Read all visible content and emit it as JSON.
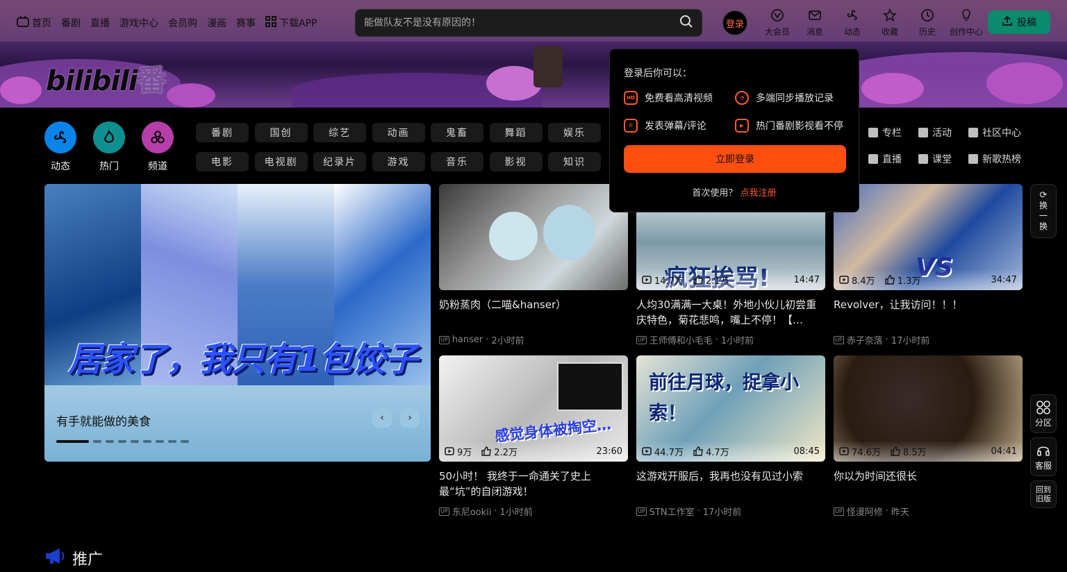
{
  "nav": {
    "menu": [
      "首页",
      "番剧",
      "直播",
      "游戏中心",
      "会员购",
      "漫画",
      "赛事",
      "下载APP"
    ],
    "search_placeholder": "能做队友不是没有原因的！",
    "login": "登录",
    "right_items": [
      "大会员",
      "消息",
      "动态",
      "收藏",
      "历史",
      "创作中心"
    ],
    "upload": "投稿"
  },
  "banner": {
    "logo_text": "bilibili",
    "logo_suffix": "番"
  },
  "channels": {
    "icons": [
      {
        "label": "动态",
        "color": "#0a84e8"
      },
      {
        "label": "热门",
        "color": "#0f8f8f"
      },
      {
        "label": "频道",
        "color": "#b63ea8"
      }
    ],
    "tags": [
      "番剧",
      "国创",
      "综艺",
      "动画",
      "鬼畜",
      "舞蹈",
      "娱乐",
      "电影",
      "电视剧",
      "纪录片",
      "游戏",
      "音乐",
      "影视",
      "知识"
    ],
    "extra": [
      "专栏",
      "活动",
      "社区中心",
      "直播",
      "课堂",
      "新歌热榜"
    ]
  },
  "carousel": {
    "overlay_text": "居家了，我只有1包饺子",
    "caption": "有手就能做的美食",
    "prev": "‹",
    "next": "›",
    "dot_count": 9
  },
  "cards": [
    {
      "title": "奶粉蒸肉（二喵&hanser）",
      "author": "hanser",
      "time": "2小时前",
      "plays": "",
      "likes": "",
      "duration": ""
    },
    {
      "title": "人均30满满一大桌！外地小伙儿初尝重庆特色，菊花悲鸣，嘴上不停！【…",
      "author": "王师傅和小毛毛",
      "time": "1小时前",
      "plays": "14.7万",
      "likes": "2.1万",
      "duration": "14:47",
      "overlay": "疯狂挨骂!"
    },
    {
      "title": "Revolver，让我访问！！！",
      "author": "赤子奈落",
      "time": "17小时前",
      "plays": "8.4万",
      "likes": "1.3万",
      "duration": "34:47",
      "overlay": "VS"
    },
    {
      "title": "50小时！ 我终于一命通关了史上最“坑”的自闭游戏！",
      "author": "东尼ookii",
      "time": "1小时前",
      "plays": "9万",
      "likes": "2.2万",
      "duration": "23:60",
      "overlay": "感觉身体被掏空…"
    },
    {
      "title": "这游戏开服后，我再也没有见过小索",
      "author": "STN工作室",
      "time": "17小时前",
      "plays": "44.7万",
      "likes": "4.7万",
      "duration": "08:45",
      "overlay": "前往月球，捉拿小索！"
    },
    {
      "title": "你以为时间还很长",
      "author": "怪漫阿修",
      "time": "昨天",
      "plays": "74.6万",
      "likes": "8.5万",
      "duration": "04:41"
    }
  ],
  "popover": {
    "heading": "登录后你可以：",
    "items": [
      "免费看高清视频",
      "多端同步播放记录",
      "发表弹幕/评论",
      "热门番剧影视看不停"
    ],
    "button": "立即登录",
    "first_use": "首次使用？",
    "register": "点我注册"
  },
  "side": {
    "refresh": "换一换",
    "zone": "分区",
    "service": "客服",
    "old": "回到旧版"
  },
  "promo": {
    "title": "推广"
  }
}
